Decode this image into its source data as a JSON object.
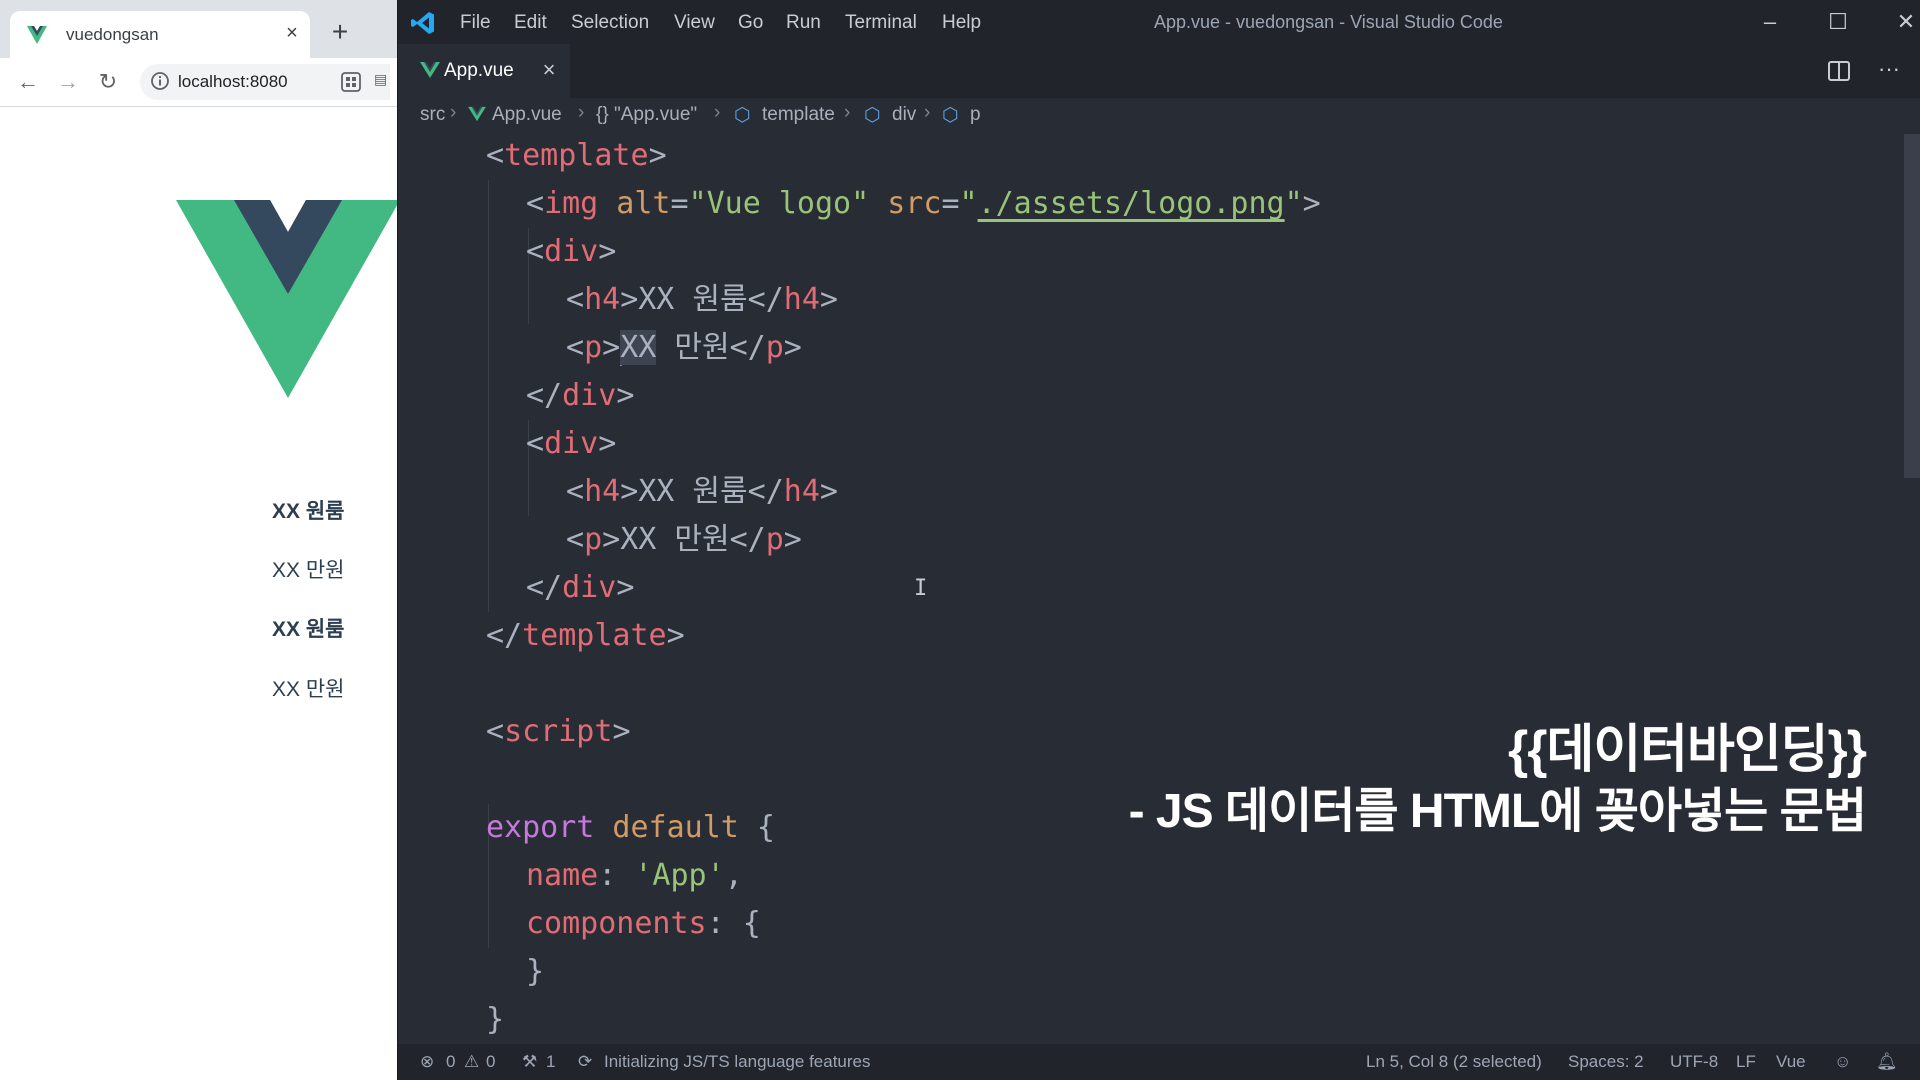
{
  "browser": {
    "tab_title": "vuedongsan",
    "url": "localhost:8080",
    "new_tab": "+",
    "close": "×",
    "content": [
      {
        "heading": "XX 원룸",
        "price": "XX 만원"
      },
      {
        "heading": "XX 원룸",
        "price": "XX 만원"
      }
    ]
  },
  "vscode": {
    "menu": [
      "File",
      "Edit",
      "Selection",
      "View",
      "Go",
      "Run",
      "Terminal",
      "Help"
    ],
    "window_title": "App.vue - vuedongsan - Visual Studio Code",
    "tab": {
      "label": "App.vue",
      "close": "×"
    },
    "more": "···",
    "breadcrumb": [
      "src",
      "App.vue",
      "{} \"App.vue\"",
      "template",
      "div",
      "p"
    ],
    "code": {
      "l1": {
        "open": "<",
        "tag": "template",
        "close": ">"
      },
      "l2": {
        "open": "<",
        "tag": "img",
        "attr1": " alt",
        "eq1": "=",
        "val1": "\"Vue logo\"",
        "attr2": " src",
        "eq2": "=",
        "q1": "\"",
        "path": "./assets/logo.png",
        "q2": "\"",
        "close": ">"
      },
      "l3": {
        "open": "<",
        "tag": "div",
        "close": ">"
      },
      "l4": {
        "open": "<",
        "tag": "h4",
        "close": ">",
        "text": "XX 원룸",
        "end_open": "</",
        "end_tag": "h4",
        "end_close": ">"
      },
      "l5": {
        "open": "<",
        "tag": "p",
        "close": ">",
        "sel": "XX",
        "text": " 만원",
        "end_open": "</",
        "end_tag": "p",
        "end_close": ">"
      },
      "l6": {
        "open": "</",
        "tag": "div",
        "close": ">"
      },
      "l7": {
        "open": "<",
        "tag": "div",
        "close": ">"
      },
      "l8": {
        "open": "<",
        "tag": "h4",
        "close": ">",
        "text": "XX 원룸",
        "end_open": "</",
        "end_tag": "h4",
        "end_close": ">"
      },
      "l9": {
        "open": "<",
        "tag": "p",
        "close": ">",
        "text": "XX 만원",
        "end_open": "</",
        "end_tag": "p",
        "end_close": ">"
      },
      "l10": {
        "open": "</",
        "tag": "div",
        "close": ">"
      },
      "l11": {
        "open": "</",
        "tag": "template",
        "close": ">"
      },
      "l13": {
        "open": "<",
        "tag": "script",
        "close": ">"
      },
      "l15": {
        "kw": "export",
        "kw2": " default",
        "rest": " {"
      },
      "l16": {
        "key": "name",
        "colon": ": ",
        "val": "'App'",
        "comma": ","
      },
      "l17": {
        "key": "components",
        "colon": ": ",
        "rest": "{"
      },
      "l18": {
        "text": "}"
      },
      "l19": {
        "text": "}"
      }
    },
    "caption": {
      "title": "{{데이터바인딩}}",
      "subtitle": "- JS 데이터를 HTML에 꽂아넣는 문법"
    },
    "status": {
      "errors": "0",
      "warnings": "0",
      "ports": "1",
      "task": "Initializing JS/TS language features",
      "position": "Ln 5, Col 8 (2 selected)",
      "spaces": "Spaces: 2",
      "encoding": "UTF-8",
      "eol": "LF",
      "language": "Vue"
    }
  },
  "colors": {
    "vue_green": "#42b883",
    "vue_dark": "#35495e",
    "editor_bg": "#282c34",
    "tag": "#e06c75",
    "attr": "#d19a66",
    "string": "#98c379",
    "keyword": "#c678dd",
    "vscode_blue": "#23a9f2"
  }
}
